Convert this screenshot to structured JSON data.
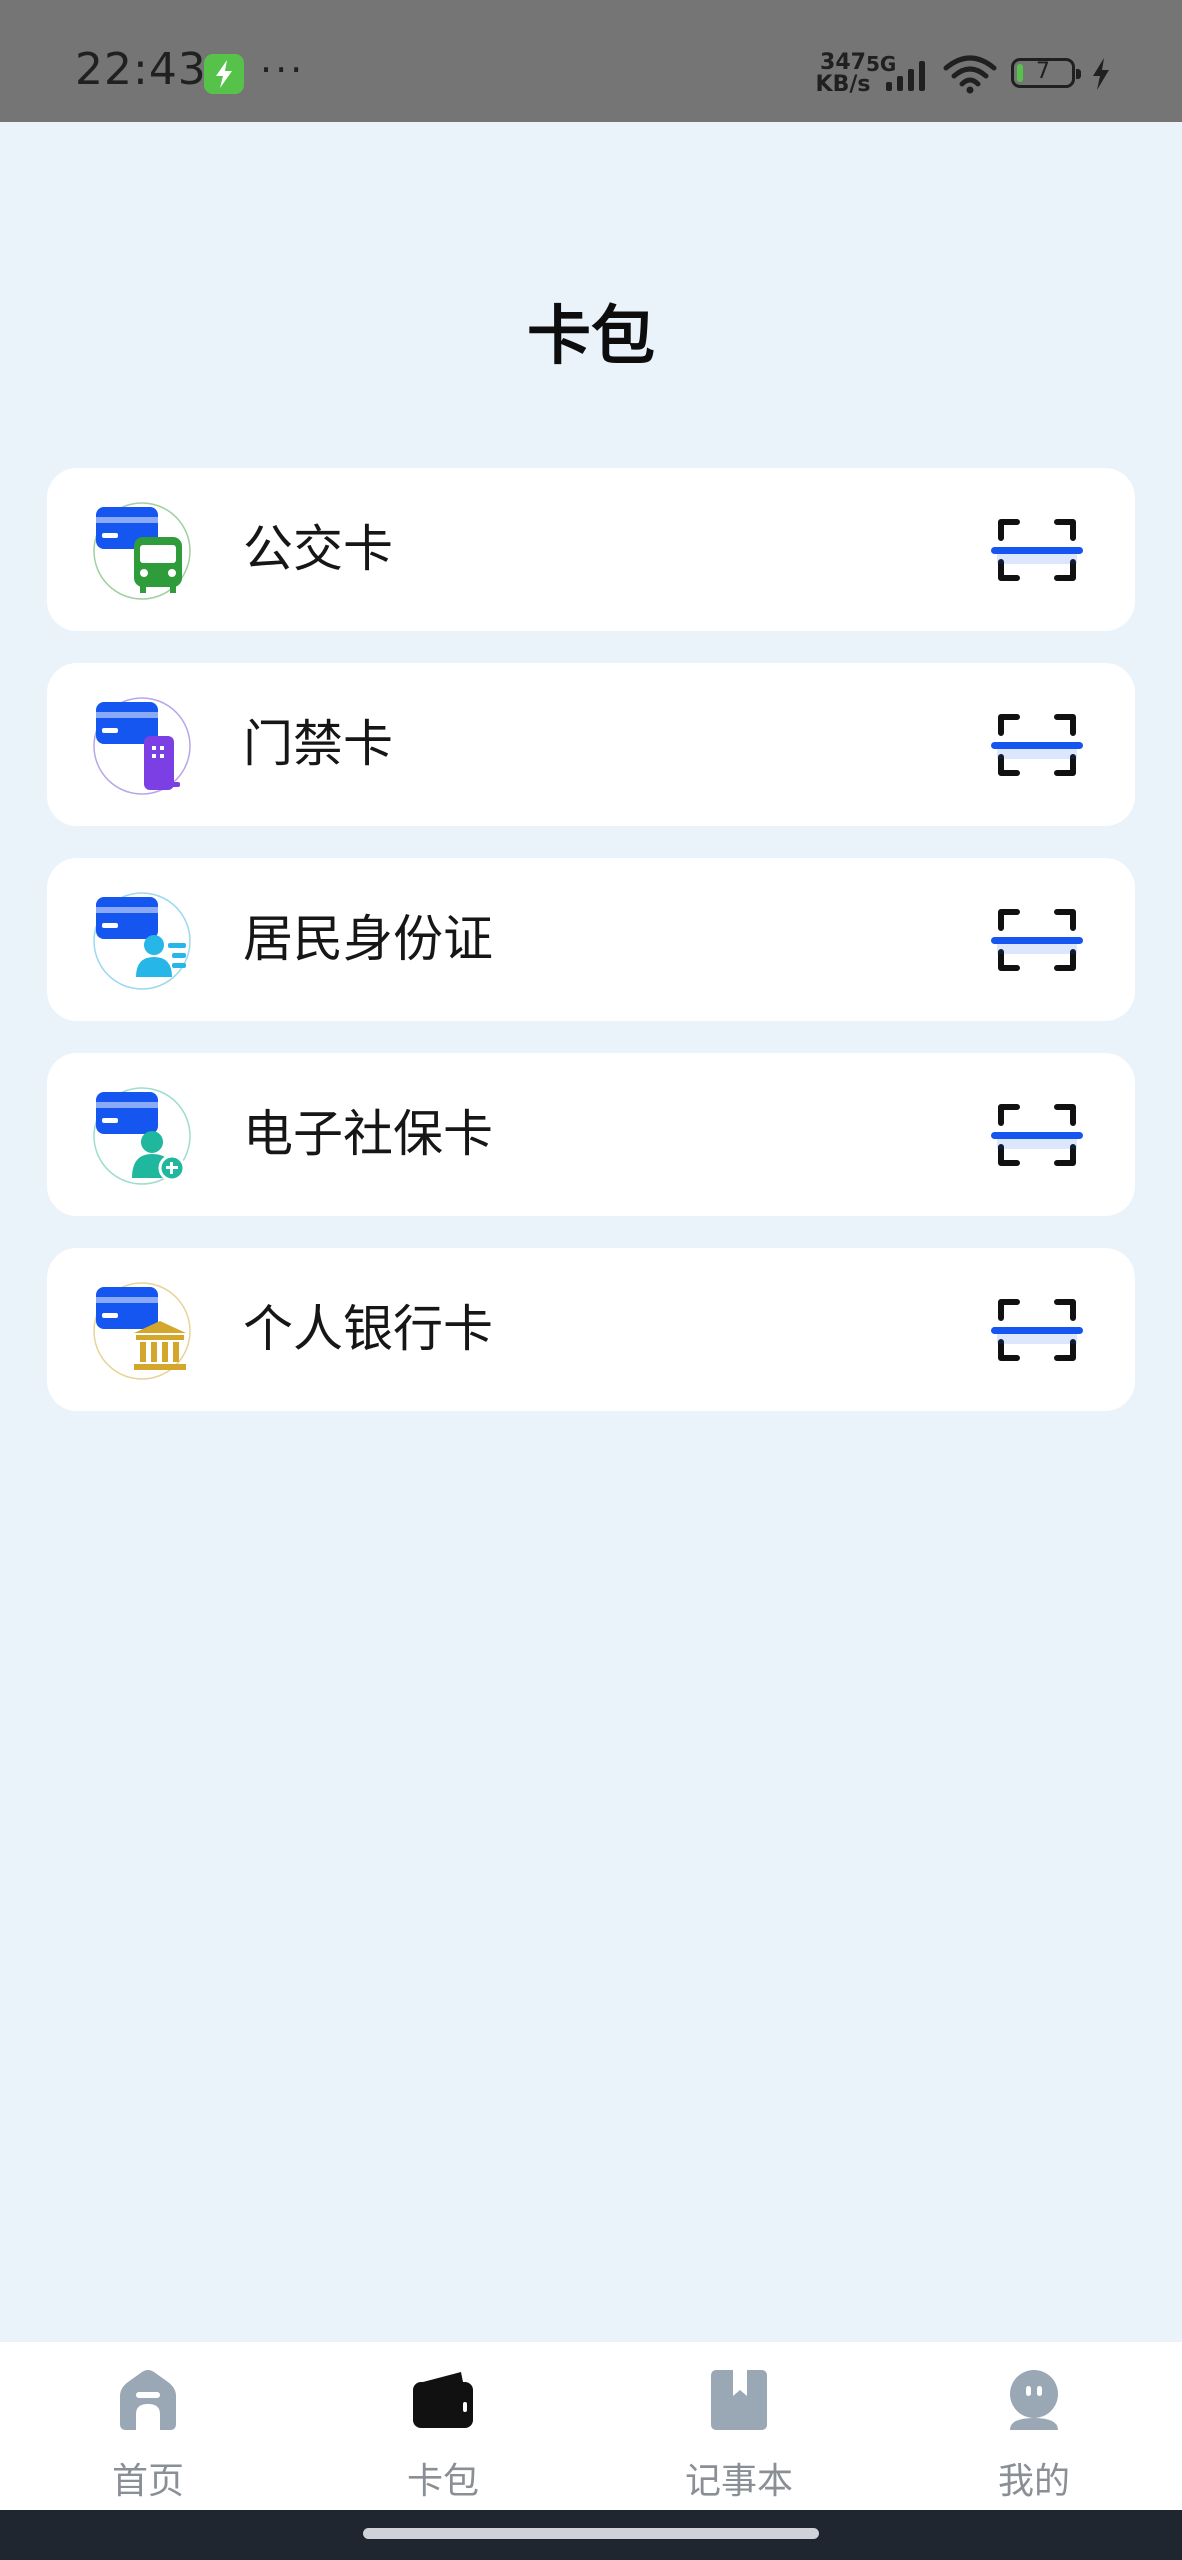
{
  "status_bar": {
    "time": "22:43",
    "more": "···",
    "net_speed_value": "347",
    "net_speed_unit": "KB/s",
    "network_type": "5G",
    "battery_level": "7",
    "icons": [
      "charging-app-icon",
      "signal-icon",
      "wifi-icon",
      "battery-icon",
      "bolt-icon"
    ]
  },
  "page": {
    "title": "卡包"
  },
  "cards": [
    {
      "label": "公交卡",
      "icon": "bus-card-icon",
      "accent": "#2F9C3C"
    },
    {
      "label": "门禁卡",
      "icon": "access-card-icon",
      "accent": "#7B3FE4"
    },
    {
      "label": "居民身份证",
      "icon": "id-card-icon",
      "accent": "#26B7E8"
    },
    {
      "label": "电子社保卡",
      "icon": "social-security-card-icon",
      "accent": "#1FB79E"
    },
    {
      "label": "个人银行卡",
      "icon": "bank-card-icon",
      "accent": "#D4A72C"
    }
  ],
  "card_primary_color": "#1555F0",
  "tabs": [
    {
      "label": "首页",
      "icon": "home-icon",
      "active": false
    },
    {
      "label": "卡包",
      "icon": "wallet-icon",
      "active": true
    },
    {
      "label": "记事本",
      "icon": "notebook-icon",
      "active": false
    },
    {
      "label": "我的",
      "icon": "profile-icon",
      "active": false
    }
  ]
}
